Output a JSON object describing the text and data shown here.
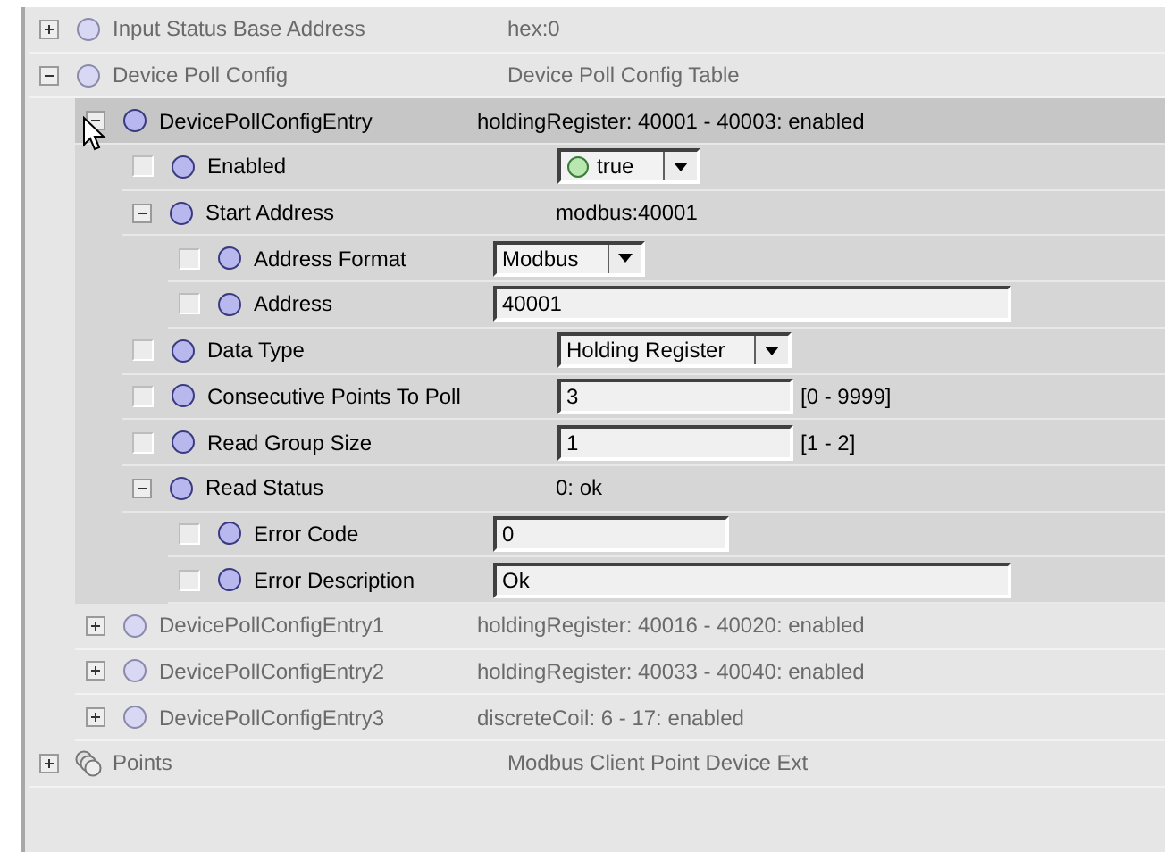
{
  "tree": [
    {
      "kind": "component",
      "label": "Input Status Base Address",
      "value": {
        "kind": "text",
        "text": "hex:0"
      },
      "expanded": false,
      "selected": false
    },
    {
      "kind": "component",
      "label": "Device Poll Config",
      "value": {
        "kind": "text",
        "text": "Device Poll Config Table"
      },
      "expanded": true,
      "selected": false,
      "children": [
        {
          "kind": "component",
          "label": "DevicePollConfigEntry",
          "value": {
            "kind": "text",
            "text": "holdingRegister: 40001 - 40003: enabled"
          },
          "expanded": true,
          "selected": true,
          "hovered": true,
          "children": [
            {
              "kind": "component",
              "label": "Enabled",
              "value": {
                "kind": "select",
                "text": "true",
                "indicator": true
              },
              "selected": false
            },
            {
              "kind": "component",
              "label": "Start Address",
              "value": {
                "kind": "text",
                "text": "modbus:40001"
              },
              "expanded": true,
              "selected": false,
              "children": [
                {
                  "kind": "component",
                  "label": "Address Format",
                  "value": {
                    "kind": "select",
                    "text": "Modbus"
                  },
                  "selected": false
                },
                {
                  "kind": "component",
                  "label": "Address",
                  "value": {
                    "kind": "wide-field",
                    "text": "40001"
                  },
                  "selected": false
                }
              ]
            },
            {
              "kind": "component",
              "label": "Data Type",
              "value": {
                "kind": "select",
                "text": "Holding Register"
              },
              "selected": false
            },
            {
              "kind": "component",
              "label": "Consecutive Points To Poll",
              "value": {
                "kind": "field",
                "text": "3",
                "range": "[0 - 9999]"
              },
              "selected": false
            },
            {
              "kind": "component",
              "label": "Read Group Size",
              "value": {
                "kind": "field",
                "text": "1",
                "range": "[1 - 2]"
              },
              "selected": false
            },
            {
              "kind": "component",
              "label": "Read Status",
              "value": {
                "kind": "text",
                "text": "0: ok"
              },
              "expanded": true,
              "selected": false,
              "children": [
                {
                  "kind": "component",
                  "label": "Error Code",
                  "value": {
                    "kind": "field",
                    "text": "0"
                  },
                  "selected": false
                },
                {
                  "kind": "component",
                  "label": "Error Description",
                  "value": {
                    "kind": "wide-field",
                    "text": "Ok"
                  },
                  "selected": false
                }
              ]
            }
          ]
        },
        {
          "kind": "component",
          "label": "DevicePollConfigEntry1",
          "value": {
            "kind": "text",
            "text": "holdingRegister: 40016 - 40020: enabled"
          },
          "expanded": false,
          "selected": false
        },
        {
          "kind": "component",
          "label": "DevicePollConfigEntry2",
          "value": {
            "kind": "text",
            "text": "holdingRegister: 40033 - 40040: enabled"
          },
          "expanded": false,
          "selected": false
        },
        {
          "kind": "component",
          "label": "DevicePollConfigEntry3",
          "value": {
            "kind": "text",
            "text": "discreteCoil: 6 - 17: enabled"
          },
          "expanded": false,
          "selected": false
        }
      ]
    },
    {
      "kind": "points",
      "label": "Points",
      "value": {
        "kind": "text",
        "text": "Modbus Client Point Device Ext"
      },
      "expanded": false,
      "selected": false
    }
  ]
}
